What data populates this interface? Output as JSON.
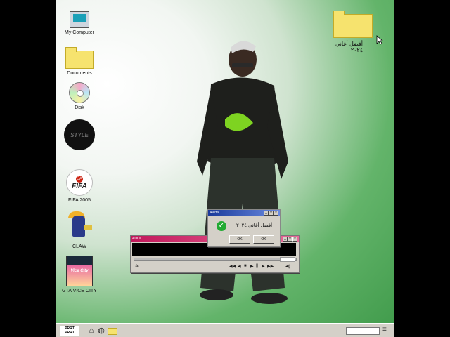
{
  "desktop": {
    "icons": [
      {
        "label": "My Computer",
        "icon": "computer-icon"
      },
      {
        "label": "Documents",
        "icon": "folder-icon"
      },
      {
        "label": "Disk",
        "icon": "disk-icon"
      },
      {
        "label": "",
        "icon": "music-disc-icon",
        "art_text": "STYLE"
      },
      {
        "label": "FIFA 2005",
        "icon": "fifa-icon",
        "art_text": "FIFA"
      },
      {
        "label": "CLAW",
        "icon": "claw-icon"
      },
      {
        "label": "GTA VICE CITY",
        "icon": "gta-icon",
        "art_text": "Vice City"
      }
    ],
    "top_folder": {
      "label": "أفضل أغاني ٢٠٢٤",
      "icon": "folder-icon"
    }
  },
  "dialog": {
    "title": "Alerta",
    "message": "أفضل أغاني ٢٠٢٤",
    "buttons": [
      "OK",
      "OK"
    ],
    "icon": "success-check-icon"
  },
  "player": {
    "title": "AUDIO",
    "controls": [
      "◀◀",
      "◀",
      "■",
      "▶",
      "||",
      "▶",
      "▶▶"
    ],
    "accent": "#c2185b"
  },
  "taskbar": {
    "start_label": "PRRT PRRT",
    "icons": [
      "home-icon",
      "globe-icon",
      "folder-icon"
    ]
  },
  "colors": {
    "bg_green": "#3f9a4a",
    "titlebar_blue": "#1a3a9a",
    "ok_green": "#22aa33"
  }
}
